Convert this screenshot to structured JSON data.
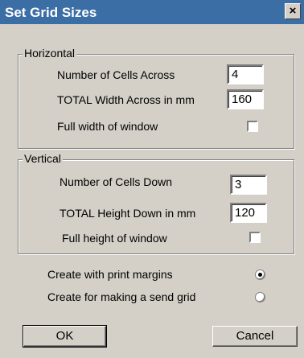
{
  "window": {
    "title": "Set Grid Sizes",
    "close_label": "×"
  },
  "horizontal": {
    "legend": "Horizontal",
    "cells_label": "Number of Cells Across",
    "cells_value": "4",
    "total_label": "TOTAL Width Across in mm",
    "total_value": "160",
    "full_label": "Full width of window",
    "full_checked": false
  },
  "vertical": {
    "legend": "Vertical",
    "cells_label": "Number of Cells Down",
    "cells_value": "3",
    "total_label": "TOTAL Height Down in mm",
    "total_value": "120",
    "full_label": "Full height of window",
    "full_checked": false
  },
  "options": {
    "print_margins_label": "Create with print margins",
    "print_margins_selected": true,
    "send_grid_label": "Create for making a send grid",
    "send_grid_selected": false
  },
  "buttons": {
    "ok_label": "OK",
    "cancel_label": "Cancel"
  }
}
